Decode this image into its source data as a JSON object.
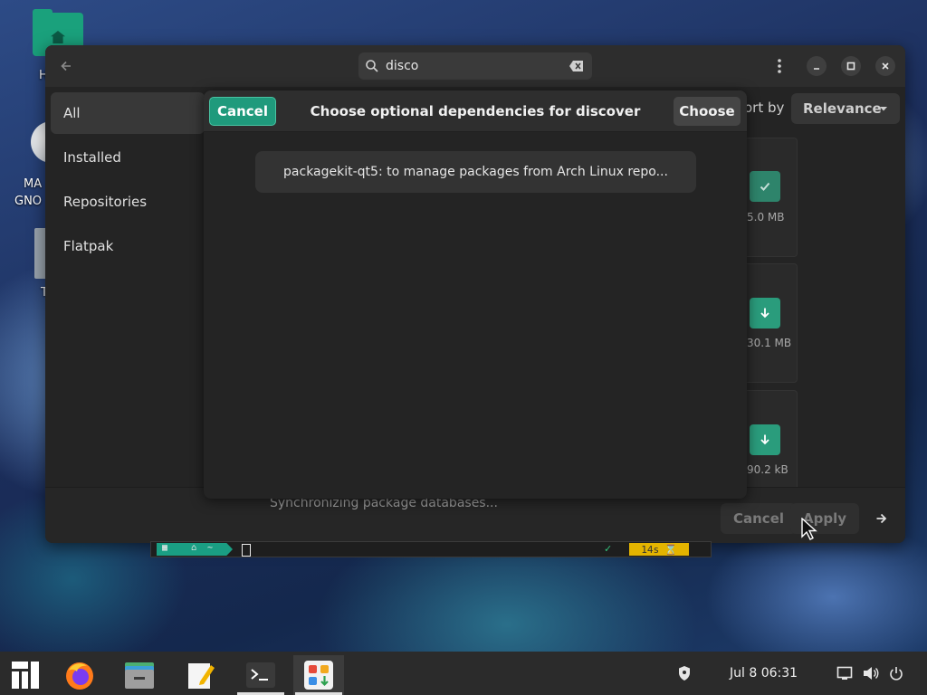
{
  "desktop": {
    "icons": [
      {
        "label": "H",
        "icon": "home-folder-icon"
      },
      {
        "label": "MA",
        "label2": "GNO",
        "icon": "disc-icon"
      },
      {
        "label": "T",
        "icon": "trash-icon"
      }
    ]
  },
  "app": {
    "search": {
      "value": "disco",
      "placeholder": ""
    },
    "sidebar": {
      "items": [
        {
          "label": "All",
          "selected": true
        },
        {
          "label": "Installed",
          "selected": false
        },
        {
          "label": "Repositories",
          "selected": false
        },
        {
          "label": "Flatpak",
          "selected": false
        }
      ]
    },
    "sort": {
      "label": "Sort by",
      "visible_label": "ort by",
      "value": "Relevance"
    },
    "packages": [
      {
        "size": "5.0 MB",
        "state": "installed",
        "icon": "check-icon"
      },
      {
        "size": "30.1 MB",
        "state": "available",
        "icon": "download-icon"
      },
      {
        "size": "90.2 kB",
        "state": "available",
        "icon": "download-icon"
      }
    ],
    "status": "Synchronizing package databases...",
    "bottom": {
      "cancel_label": "Cancel",
      "apply_label": "Apply"
    }
  },
  "dialog": {
    "cancel_label": "Cancel",
    "title": "Choose optional dependencies for discover",
    "choose_label": "Choose",
    "items": [
      {
        "label": "packagekit-qt5: to manage packages from Arch Linux repo..."
      }
    ]
  },
  "terminal": {
    "path": "~",
    "duration": "14s"
  },
  "taskbar": {
    "clock": "Jul 8  06:31",
    "apps": [
      "manjaro-menu-icon",
      "firefox-icon",
      "file-manager-icon",
      "text-editor-icon",
      "terminal-icon",
      "software-center-icon"
    ]
  },
  "colors": {
    "accent": "#1f9a7c",
    "window_bg": "#242424",
    "header_bg": "#2d2d2d"
  }
}
